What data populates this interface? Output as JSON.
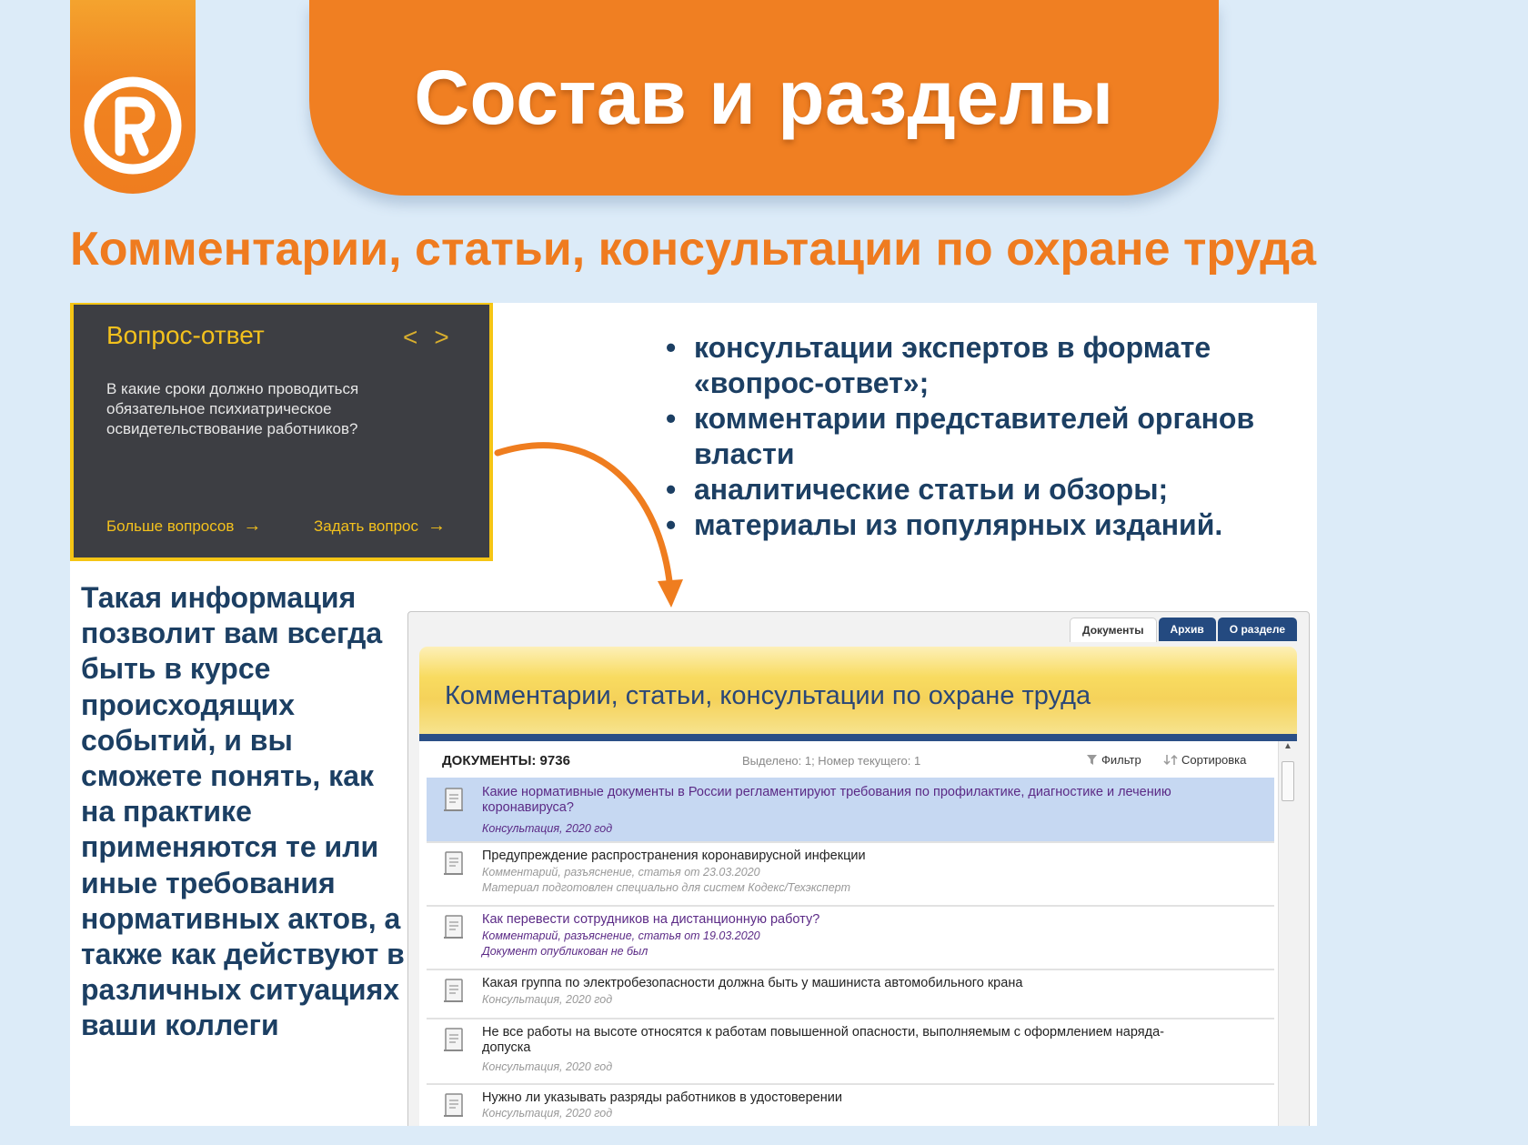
{
  "colors": {
    "accent": "#f07f22",
    "navy": "#1c3f63",
    "widget_bg": "#3d3e43",
    "widget_yellow": "#f3c11d",
    "tab_blue": "#244a80"
  },
  "header": {
    "title": "Состав и разделы",
    "logo_icon": "registered-r-icon"
  },
  "subtitle": "Комментарии, статьи, консультации по охране труда",
  "qa_widget": {
    "title": "Вопрос-ответ",
    "prev": "<",
    "next": ">",
    "question": "В какие сроки должно проводиться обязательное психиатрическое освидетельствование работников?",
    "more_link": "Больше вопросов",
    "ask_link": "Задать вопрос",
    "arrow": "→"
  },
  "bullets": [
    "консультации экспертов в формате «вопрос-ответ»;",
    "комментарии представителей органов власти",
    "аналитические статьи и обзоры;",
    "материалы из популярных изданий."
  ],
  "info_text": "Такая информация позволит вам всегда быть в курсе происходящих событий, и вы сможете понять, как на практике применяются те или иные требования нормативных актов, а также как действуют в различных ситуациях ваши коллеги",
  "doc_panel": {
    "tabs": [
      "Документы",
      "Архив",
      "О разделе"
    ],
    "title": "Комментарии, статьи, консультации по охране труда",
    "count_label": "ДОКУМЕНТЫ: 9736",
    "selected_info": "Выделено: 1; Номер текущего: 1",
    "filter": "Фильтр",
    "sort": "Сортировка",
    "rows": [
      {
        "title": "Какие нормативные документы в России регламентируют требования по профилактике, диагностике и лечению коронавируса?",
        "meta1": "Консультация, 2020 год",
        "meta2": ""
      },
      {
        "title": "Предупреждение распространения коронавирусной инфекции",
        "meta1": "Комментарий, разъяснение, статья от 23.03.2020",
        "meta2": "Материал подготовлен специально для систем Кодекс/Техэксперт"
      },
      {
        "title": "Как перевести сотрудников на дистанционную работу?",
        "meta1": "Комментарий, разъяснение, статья от 19.03.2020",
        "meta2": "Документ опубликован не был"
      },
      {
        "title": "Какая группа по электробезопасности должна быть у машиниста автомобильного крана",
        "meta1": "Консультация, 2020 год",
        "meta2": ""
      },
      {
        "title": "Не все работы на высоте относятся к работам повышенной опасности, выполняемым с оформлением наряда-допуска",
        "meta1": "Консультация, 2020 год",
        "meta2": ""
      },
      {
        "title": "Нужно ли указывать разряды работников в удостоверении",
        "meta1": "Консультация, 2020 год",
        "meta2": ""
      }
    ]
  }
}
